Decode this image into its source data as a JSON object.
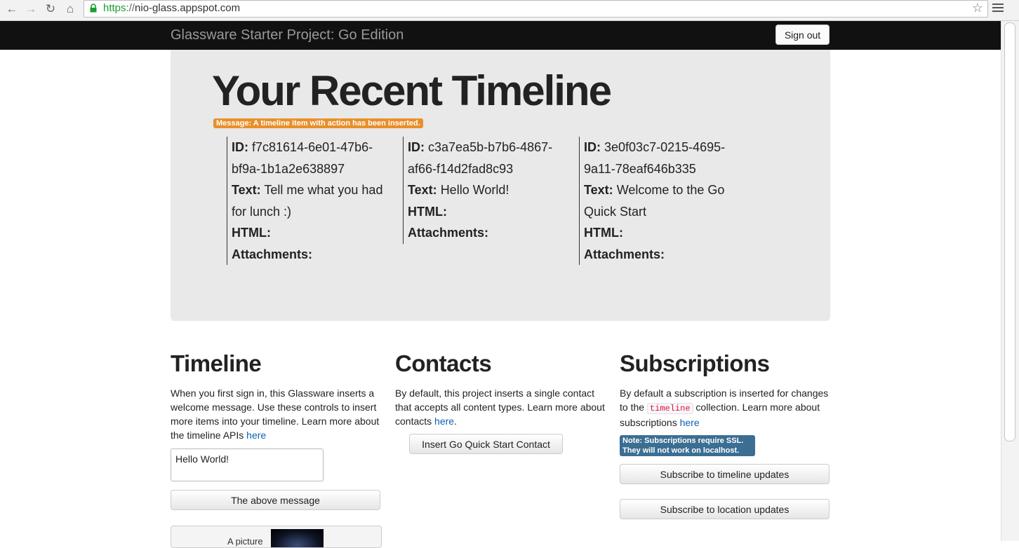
{
  "browser": {
    "url_scheme": "https",
    "url_sep": "://",
    "url_host": "nio-glass.appspot.com"
  },
  "navbar": {
    "brand": "Glassware Starter Project: Go Edition",
    "signout_label": "Sign out"
  },
  "hero": {
    "title": "Your Recent Timeline",
    "message": "Message: A timeline item with action has been inserted.",
    "items": [
      {
        "id": "f7c81614-6e01-47b6-bf9a-1b1a2e638897",
        "text": "Tell me what you had for lunch :)"
      },
      {
        "id": "c3a7ea5b-b7b6-4867-af66-f14d2fad8c93",
        "text": "Hello World!"
      },
      {
        "id": "3e0f03c7-0215-4695-9a11-78eaf646b335",
        "text": "Welcome to the Go Quick Start"
      }
    ],
    "labels": {
      "id": "ID:",
      "text": "Text:",
      "html": "HTML:",
      "attachments": "Attachments:"
    }
  },
  "timeline": {
    "heading": "Timeline",
    "desc": "When you first sign in, this Glassware inserts a welcome message. Use these controls to insert more items into your timeline. Learn more about the timeline APIs ",
    "link": "here",
    "textarea_value": "Hello World!",
    "button_label": "The above message",
    "partial_button_label": "A picture"
  },
  "contacts": {
    "heading": "Contacts",
    "desc": "By default, this project inserts a single contact that accepts all content types. Learn more about contacts ",
    "link": "here",
    "period": ".",
    "button_label": "Insert Go Quick Start Contact"
  },
  "subscriptions": {
    "heading": "Subscriptions",
    "desc_before": "By default a subscription is inserted for changes to the ",
    "code": "timeline",
    "desc_after": " collection. Learn more about subscriptions ",
    "link": "here",
    "note_line1": "Note: Subscriptions require SSL.",
    "note_line2": "They will not work on localhost.",
    "button_timeline": "Subscribe to timeline updates",
    "button_location": "Subscribe to location updates"
  },
  "colors": {
    "navbar_bg": "#111111",
    "hero_bg": "#e9e9e9",
    "message_badge": "#e88f2a",
    "note_badge": "#3b6e92",
    "link": "#0a62b3"
  }
}
